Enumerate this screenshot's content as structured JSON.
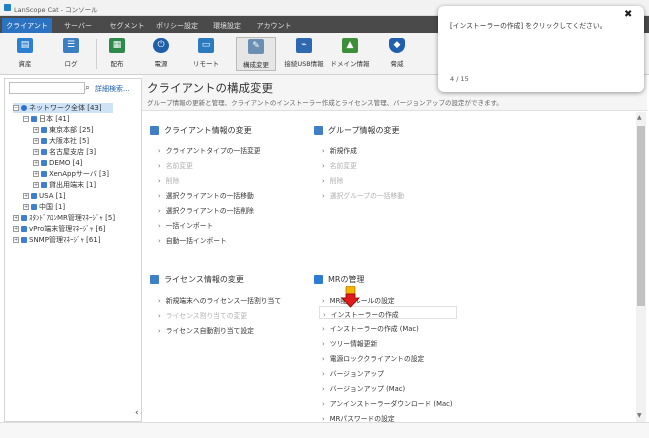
{
  "window": {
    "title": "LanScope Cat - コンソール"
  },
  "tabs": [
    {
      "label": "クライアント",
      "active": true
    },
    {
      "label": "サーバー"
    },
    {
      "label": "セグメント"
    },
    {
      "label": "ポリシー設定"
    },
    {
      "label": "環境設定"
    },
    {
      "label": "アカウント"
    }
  ],
  "toolbar": [
    {
      "label": "資産",
      "icon": "asset-icon",
      "color": "#2d7fd0"
    },
    {
      "label": "ログ",
      "icon": "log-icon",
      "color": "#3a7fc2"
    },
    {
      "label": "配布",
      "icon": "distribute-icon",
      "color": "#2d8a4a"
    },
    {
      "label": "電源",
      "icon": "power-icon",
      "color": "#1f5ea8"
    },
    {
      "label": "リモート",
      "icon": "remote-icon",
      "color": "#2c7bbf"
    },
    {
      "label": "構成変更",
      "icon": "config-icon",
      "color": "#6b8fb3",
      "selected": true
    },
    {
      "label": "接続USB情報",
      "icon": "usb-icon",
      "color": "#2e68b0"
    },
    {
      "label": "ドメイン情報",
      "icon": "domain-icon",
      "color": "#3e8f3a"
    },
    {
      "label": "脅威",
      "icon": "shield-icon",
      "color": "#1f5fae"
    }
  ],
  "sidebar": {
    "search_placeholder": "",
    "advanced_search": "詳細検索...",
    "tree": [
      {
        "label": "ネットワーク全体 [43]"
      },
      {
        "label": "日本 [41]"
      },
      {
        "label": "東京本部 [25]"
      },
      {
        "label": "大阪本社 [5]"
      },
      {
        "label": "名古屋支店 [3]"
      },
      {
        "label": "DEMO [4]"
      },
      {
        "label": "XenAppサーバ [3]"
      },
      {
        "label": "貸出用端末 [1]"
      },
      {
        "label": "USA [1]"
      },
      {
        "label": "中国 [1]"
      },
      {
        "label": "ｽﾀﾝﾄﾞｱﾛﾝMR管理ﾏﾈｰｼﾞｬ [5]"
      },
      {
        "label": "vPro端末管理ﾏﾈｰｼﾞｬ [6]"
      },
      {
        "label": "SNMP管理ﾏﾈｰｼﾞｬ [61]"
      }
    ]
  },
  "main": {
    "title": "クライアントの構成変更",
    "subtitle": "グループ情報の更新と管理、クライアントのインストーラー作成とライセンス管理、バージョンアップの設定ができます。",
    "sections": [
      {
        "title": "クライアント情報の変更",
        "color": "#3f7fc6",
        "items": [
          {
            "label": "クライアントタイプの一括変更",
            "enabled": true
          },
          {
            "label": "名前変更",
            "enabled": false
          },
          {
            "label": "削除",
            "enabled": false
          },
          {
            "label": "選択クライアントの一括移動",
            "enabled": true
          },
          {
            "label": "選択クライアントの一括削除",
            "enabled": true
          },
          {
            "label": "一括インポート",
            "enabled": true
          },
          {
            "label": "自動一括インポート",
            "enabled": true
          }
        ]
      },
      {
        "title": "グループ情報の変更",
        "color": "#3f7fc6",
        "items": [
          {
            "label": "新規作成",
            "enabled": true
          },
          {
            "label": "名前変更",
            "enabled": false
          },
          {
            "label": "削除",
            "enabled": false
          },
          {
            "label": "選択グループの一括移動",
            "enabled": false
          }
        ]
      },
      {
        "title": "ライセンス情報の変更",
        "color": "#3f7fc6",
        "items": [
          {
            "label": "新規端末へのライセンス一括割り当て",
            "enabled": true
          },
          {
            "label": "ライセンス割り当ての変更",
            "enabled": false
          },
          {
            "label": "ライセンス自動割り当て設定",
            "enabled": true
          }
        ]
      },
      {
        "title": "MRの管理",
        "color": "#2e7bd6",
        "items": [
          {
            "label": "MR配布ルールの設定",
            "enabled": true
          },
          {
            "label": "インストーラーの作成",
            "enabled": true,
            "highlight": true
          },
          {
            "label": "インストーラーの作成 (Mac)",
            "enabled": true
          },
          {
            "label": "ツリー情報更新",
            "enabled": true
          },
          {
            "label": "電源ロッククライアントの設定",
            "enabled": true
          },
          {
            "label": "バージョンアップ",
            "enabled": true
          },
          {
            "label": "バージョンアップ (Mac)",
            "enabled": true
          },
          {
            "label": "アンインストーラーダウンロード (Mac)",
            "enabled": true
          },
          {
            "label": "MRパスワードの設定",
            "enabled": true
          }
        ]
      }
    ]
  },
  "toast": {
    "message": "[インストーラーの作成] をクリックしてください。",
    "progress": "4 / 15"
  }
}
